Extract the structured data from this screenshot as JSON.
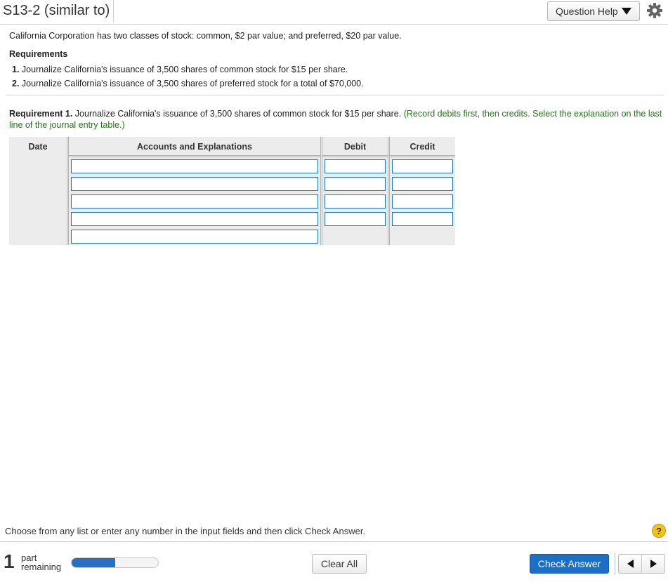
{
  "header": {
    "title": "S13-2 (similar to)",
    "question_help_label": "Question Help"
  },
  "problem": {
    "statement": "California Corporation has two classes of stock: common, $2 par value; and preferred, $20 par value.",
    "requirements_title": "Requirements",
    "requirements": [
      {
        "num": "1.",
        "text": "Journalize California's issuance of 3,500 shares of common stock for $15 per share."
      },
      {
        "num": "2.",
        "text": "Journalize California's issuance of 3,500 shares of preferred stock for a total of $70,000."
      }
    ]
  },
  "instruction": {
    "label": "Requirement 1.",
    "text": "Journalize California's issuance of 3,500 shares of common stock for $15 per share.",
    "hint": "(Record debits first, then credits. Select the explanation on the last line of the journal entry table.)"
  },
  "journal": {
    "columns": {
      "date": "Date",
      "accounts": "Accounts and Explanations",
      "debit": "Debit",
      "credit": "Credit"
    },
    "rows": [
      {
        "account": "",
        "debit": "",
        "credit": ""
      },
      {
        "account": "",
        "debit": "",
        "credit": ""
      },
      {
        "account": "",
        "debit": "",
        "credit": ""
      },
      {
        "account": "",
        "debit": "",
        "credit": ""
      },
      {
        "account": ""
      }
    ]
  },
  "footer": {
    "message": "Choose from any list or enter any number in the input fields and then click Check Answer.",
    "help_symbol": "?",
    "parts_remaining": "1",
    "parts_label_1": "part",
    "parts_label_2": "remaining",
    "progress_fraction": 0.5,
    "clear_all_label": "Clear All",
    "check_answer_label": "Check Answer"
  },
  "colors": {
    "accent_blue": "#1c6fc2",
    "hint_green": "#1e7a12",
    "input_border": "#1a7ab8",
    "help_yellow": "#f1c21b"
  }
}
